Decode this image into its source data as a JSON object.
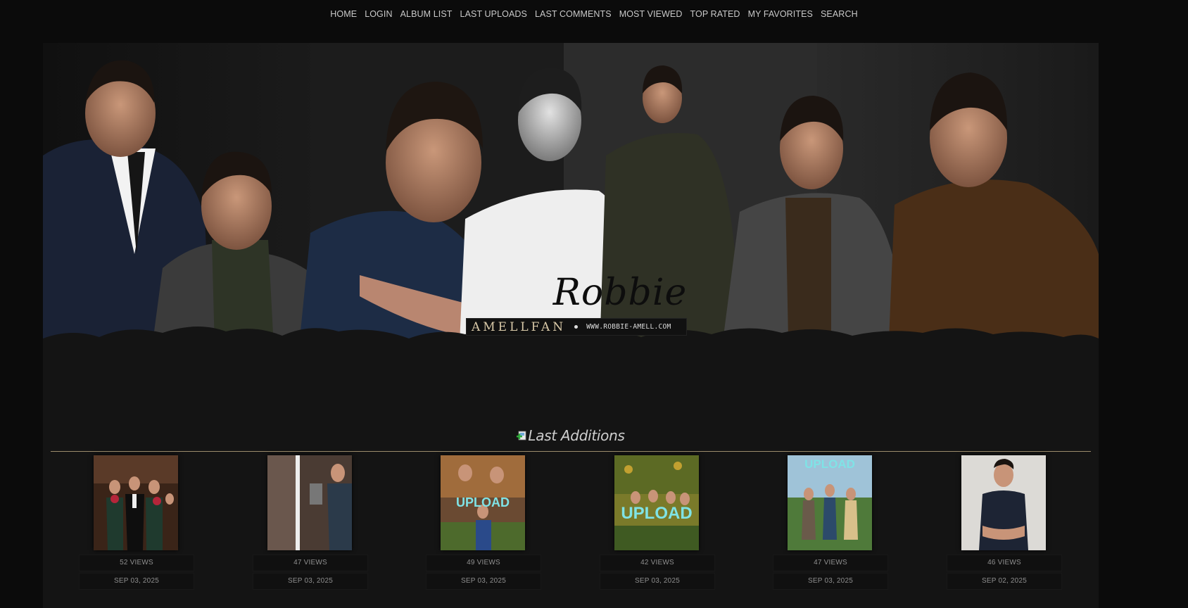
{
  "nav": {
    "items": [
      "HOME",
      "LOGIN",
      "ALBUM LIST",
      "LAST UPLOADS",
      "LAST COMMENTS",
      "MOST VIEWED",
      "TOP RATED",
      "MY FAVORITES",
      "SEARCH"
    ]
  },
  "banner": {
    "logo_script": "Robbie",
    "logo_name": "AMELLFAN",
    "logo_url": "WWW.ROBBIE-AMELL.COM"
  },
  "section": {
    "title": "Last Additions",
    "icon": "add-image-icon"
  },
  "thumbnails": [
    {
      "views": "52 VIEWS",
      "date": "SEP 03, 2025"
    },
    {
      "views": "47 VIEWS",
      "date": "SEP 03, 2025"
    },
    {
      "views": "49 VIEWS",
      "date": "SEP 03, 2025",
      "overlay": "UPLOAD"
    },
    {
      "views": "42 VIEWS",
      "date": "SEP 03, 2025",
      "overlay": "UPLOAD"
    },
    {
      "views": "47 VIEWS",
      "date": "SEP 03, 2025",
      "overlay": "UPLOAD"
    },
    {
      "views": "46 VIEWS",
      "date": "SEP 02, 2025"
    }
  ],
  "colors": {
    "background": "#0b0b0b",
    "frame": "#141414",
    "divider": "#9b8c6c",
    "upload_text": "#7fe3e6"
  }
}
